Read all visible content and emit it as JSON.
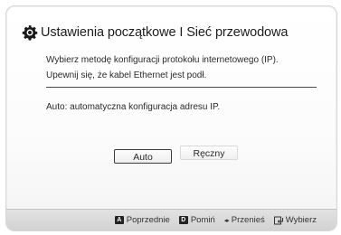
{
  "dialog": {
    "title": "Ustawienia początkowe I Sieć przewodowa",
    "instructions": [
      "Wybierz metodę konfiguracji protokołu internetowego (IP).",
      "Upewnij się, że kabel Ethernet jest podł."
    ],
    "auto_description": "Auto: automatyczna konfiguracja adresu IP.",
    "buttons": {
      "auto": "Auto",
      "manual": "Ręczny"
    },
    "selected": "auto"
  },
  "footer": {
    "hints": [
      {
        "key": "A",
        "label": "Poprzednie",
        "icon": "a-key-icon"
      },
      {
        "key": "D",
        "label": "Pomiń",
        "icon": "d-key-icon"
      },
      {
        "key": "◂▸",
        "label": "Przenieś",
        "icon": "left-right-arrows-icon"
      },
      {
        "key": "",
        "label": "Wybierz",
        "icon": "enter-icon"
      }
    ]
  }
}
